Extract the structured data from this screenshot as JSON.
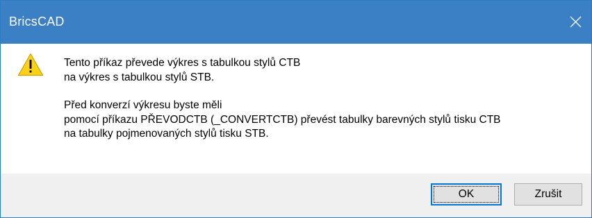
{
  "window": {
    "title": "BricsCAD",
    "close_glyph": "close-icon"
  },
  "message": {
    "icon": "warning-icon",
    "paragraph1": [
      "Tento příkaz převede výkres s tabulkou stylů CTB",
      "na výkres s tabulkou stylů STB."
    ],
    "paragraph2": [
      "Před konverzí výkresu byste měli",
      "pomocí příkazu PŘEVODCTB (_CONVERTCTB) převést tabulky barevných stylů tisku CTB",
      "na tabulky pojmenovaných stylů tisku STB."
    ]
  },
  "buttons": {
    "ok_label": "OK",
    "cancel_label": "Zrušit"
  },
  "colors": {
    "titlebar": "#3b7fc4",
    "footer": "#f0f0f0",
    "warning_fill": "#fcd116",
    "focus_border": "#0078d7"
  }
}
